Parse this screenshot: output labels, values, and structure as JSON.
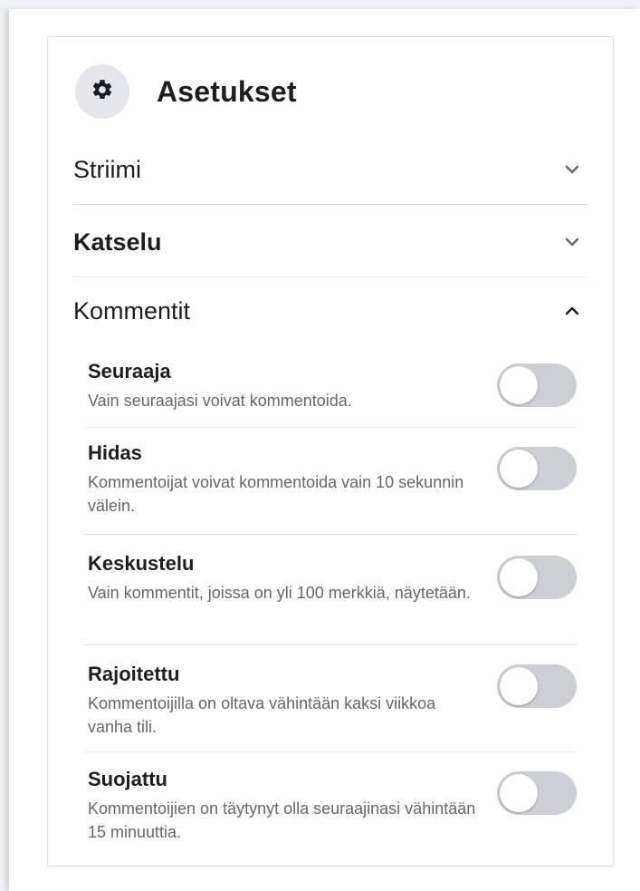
{
  "header": {
    "title": "Asetukset",
    "icon": "gear-icon"
  },
  "sections": [
    {
      "label": "Striimi",
      "expanded": false,
      "icon": "chevron-down-icon"
    },
    {
      "label": "Katselu",
      "expanded": false,
      "icon": "chevron-down-icon"
    },
    {
      "label": "Kommentit",
      "expanded": true,
      "icon": "chevron-up-icon"
    }
  ],
  "comment_options": [
    {
      "title": "Seuraaja",
      "description": "Vain seuraajasi voivat kommentoida.",
      "enabled": false
    },
    {
      "title": "Hidas",
      "description": "Kommentoijat voivat kommentoida vain 10 sekunnin välein.",
      "enabled": false
    },
    {
      "title": "Keskustelu",
      "description": "Vain kommentit, joissa on yli 100 merkkiä, näytetään.",
      "enabled": false
    },
    {
      "title": "Rajoitettu",
      "description": "Kommentoijilla on oltava vähintään kaksi viikkoa vanha tili.",
      "enabled": false
    },
    {
      "title": "Suojattu",
      "description": "Kommentoijien on täytynyt olla seuraajinasi vähintään 15 minuuttia.",
      "enabled": false
    }
  ],
  "colors": {
    "toggle_off": "#ccd0d5",
    "icon_bg": "#e4e6eb",
    "text_primary": "#1c1e21",
    "text_secondary": "#65676b"
  }
}
